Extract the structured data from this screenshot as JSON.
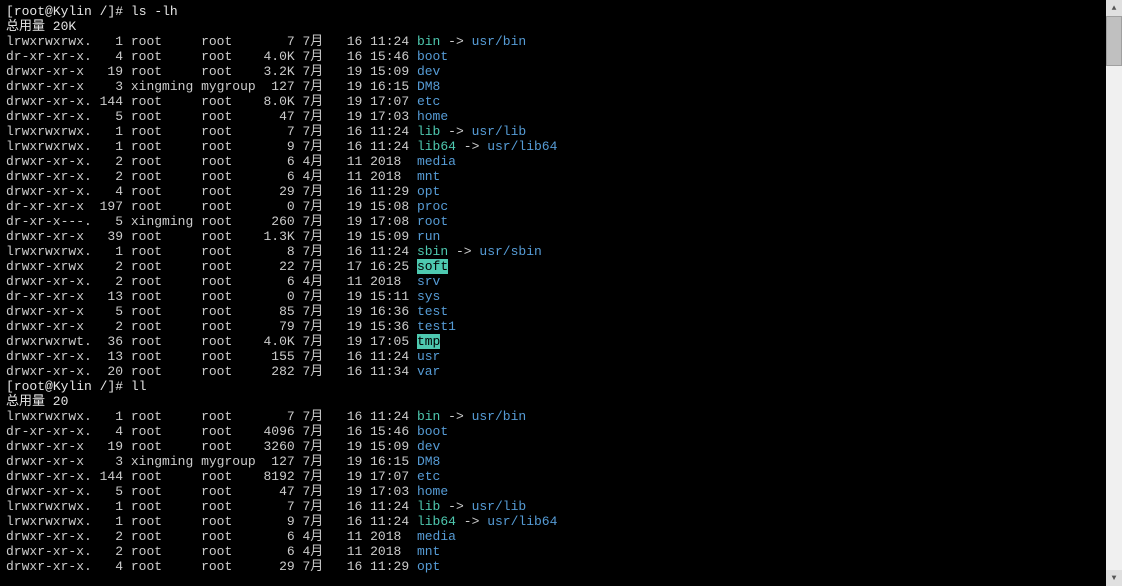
{
  "prompt1": {
    "user": "root",
    "host": "Kylin",
    "path": "/",
    "symbol": "#",
    "command": "ls -lh"
  },
  "total1": "总用量 20K",
  "listing1": [
    {
      "perms": "lrwxrwxrwx.",
      "links": "1",
      "owner": "root",
      "group": "root",
      "size": "7",
      "month": "7月",
      "day": "16",
      "time": "11:24",
      "name": "bin",
      "arrow": " -> ",
      "target": "usr/bin",
      "nameClass": "cyan",
      "targetClass": "blue"
    },
    {
      "perms": "dr-xr-xr-x.",
      "links": "4",
      "owner": "root",
      "group": "root",
      "size": "4.0K",
      "month": "7月",
      "day": "16",
      "time": "15:46",
      "name": "boot",
      "nameClass": "blue"
    },
    {
      "perms": "drwxr-xr-x",
      "links": "19",
      "owner": "root",
      "group": "root",
      "size": "3.2K",
      "month": "7月",
      "day": "19",
      "time": "15:09",
      "name": "dev",
      "nameClass": "blue"
    },
    {
      "perms": "drwxr-xr-x",
      "links": "3",
      "owner": "xingming",
      "group": "mygroup",
      "size": "127",
      "month": "7月",
      "day": "19",
      "time": "16:15",
      "name": "DM8",
      "nameClass": "blue"
    },
    {
      "perms": "drwxr-xr-x.",
      "links": "144",
      "owner": "root",
      "group": "root",
      "size": "8.0K",
      "month": "7月",
      "day": "19",
      "time": "17:07",
      "name": "etc",
      "nameClass": "blue"
    },
    {
      "perms": "drwxr-xr-x.",
      "links": "5",
      "owner": "root",
      "group": "root",
      "size": "47",
      "month": "7月",
      "day": "19",
      "time": "17:03",
      "name": "home",
      "nameClass": "blue"
    },
    {
      "perms": "lrwxrwxrwx.",
      "links": "1",
      "owner": "root",
      "group": "root",
      "size": "7",
      "month": "7月",
      "day": "16",
      "time": "11:24",
      "name": "lib",
      "arrow": " -> ",
      "target": "usr/lib",
      "nameClass": "cyan",
      "targetClass": "blue"
    },
    {
      "perms": "lrwxrwxrwx.",
      "links": "1",
      "owner": "root",
      "group": "root",
      "size": "9",
      "month": "7月",
      "day": "16",
      "time": "11:24",
      "name": "lib64",
      "arrow": " -> ",
      "target": "usr/lib64",
      "nameClass": "cyan",
      "targetClass": "blue"
    },
    {
      "perms": "drwxr-xr-x.",
      "links": "2",
      "owner": "root",
      "group": "root",
      "size": "6",
      "month": "4月",
      "day": "11",
      "time": "2018",
      "name": "media",
      "nameClass": "blue"
    },
    {
      "perms": "drwxr-xr-x.",
      "links": "2",
      "owner": "root",
      "group": "root",
      "size": "6",
      "month": "4月",
      "day": "11",
      "time": "2018",
      "name": "mnt",
      "nameClass": "blue"
    },
    {
      "perms": "drwxr-xr-x.",
      "links": "4",
      "owner": "root",
      "group": "root",
      "size": "29",
      "month": "7月",
      "day": "16",
      "time": "11:29",
      "name": "opt",
      "nameClass": "blue"
    },
    {
      "perms": "dr-xr-xr-x",
      "links": "197",
      "owner": "root",
      "group": "root",
      "size": "0",
      "month": "7月",
      "day": "19",
      "time": "15:08",
      "name": "proc",
      "nameClass": "blue"
    },
    {
      "perms": "dr-xr-x---.",
      "links": "5",
      "owner": "xingming",
      "group": "root",
      "size": "260",
      "month": "7月",
      "day": "19",
      "time": "17:08",
      "name": "root",
      "nameClass": "blue"
    },
    {
      "perms": "drwxr-xr-x",
      "links": "39",
      "owner": "root",
      "group": "root",
      "size": "1.3K",
      "month": "7月",
      "day": "19",
      "time": "15:09",
      "name": "run",
      "nameClass": "blue"
    },
    {
      "perms": "lrwxrwxrwx.",
      "links": "1",
      "owner": "root",
      "group": "root",
      "size": "8",
      "month": "7月",
      "day": "16",
      "time": "11:24",
      "name": "sbin",
      "arrow": " -> ",
      "target": "usr/sbin",
      "nameClass": "cyan",
      "targetClass": "blue"
    },
    {
      "perms": "drwxr-xrwx",
      "links": "2",
      "owner": "root",
      "group": "root",
      "size": "22",
      "month": "7月",
      "day": "17",
      "time": "16:25",
      "name": "soft",
      "nameClass": "hl-green"
    },
    {
      "perms": "drwxr-xr-x.",
      "links": "2",
      "owner": "root",
      "group": "root",
      "size": "6",
      "month": "4月",
      "day": "11",
      "time": "2018",
      "name": "srv",
      "nameClass": "blue"
    },
    {
      "perms": "dr-xr-xr-x",
      "links": "13",
      "owner": "root",
      "group": "root",
      "size": "0",
      "month": "7月",
      "day": "19",
      "time": "15:11",
      "name": "sys",
      "nameClass": "blue"
    },
    {
      "perms": "drwxr-xr-x",
      "links": "5",
      "owner": "root",
      "group": "root",
      "size": "85",
      "month": "7月",
      "day": "19",
      "time": "16:36",
      "name": "test",
      "nameClass": "blue"
    },
    {
      "perms": "drwxr-xr-x",
      "links": "2",
      "owner": "root",
      "group": "root",
      "size": "79",
      "month": "7月",
      "day": "19",
      "time": "15:36",
      "name": "test1",
      "nameClass": "blue"
    },
    {
      "perms": "drwxrwxrwt.",
      "links": "36",
      "owner": "root",
      "group": "root",
      "size": "4.0K",
      "month": "7月",
      "day": "19",
      "time": "17:05",
      "name": "tmp",
      "nameClass": "hl-green"
    },
    {
      "perms": "drwxr-xr-x.",
      "links": "13",
      "owner": "root",
      "group": "root",
      "size": "155",
      "month": "7月",
      "day": "16",
      "time": "11:24",
      "name": "usr",
      "nameClass": "blue"
    },
    {
      "perms": "drwxr-xr-x.",
      "links": "20",
      "owner": "root",
      "group": "root",
      "size": "282",
      "month": "7月",
      "day": "16",
      "time": "11:34",
      "name": "var",
      "nameClass": "blue"
    }
  ],
  "prompt2": {
    "user": "root",
    "host": "Kylin",
    "path": "/",
    "symbol": "#",
    "command": "ll"
  },
  "total2": "总用量 20",
  "listing2": [
    {
      "perms": "lrwxrwxrwx.",
      "links": "1",
      "owner": "root",
      "group": "root",
      "size": "7",
      "month": "7月",
      "day": "16",
      "time": "11:24",
      "name": "bin",
      "arrow": " -> ",
      "target": "usr/bin",
      "nameClass": "cyan",
      "targetClass": "blue"
    },
    {
      "perms": "dr-xr-xr-x.",
      "links": "4",
      "owner": "root",
      "group": "root",
      "size": "4096",
      "month": "7月",
      "day": "16",
      "time": "15:46",
      "name": "boot",
      "nameClass": "blue"
    },
    {
      "perms": "drwxr-xr-x",
      "links": "19",
      "owner": "root",
      "group": "root",
      "size": "3260",
      "month": "7月",
      "day": "19",
      "time": "15:09",
      "name": "dev",
      "nameClass": "blue"
    },
    {
      "perms": "drwxr-xr-x",
      "links": "3",
      "owner": "xingming",
      "group": "mygroup",
      "size": "127",
      "month": "7月",
      "day": "19",
      "time": "16:15",
      "name": "DM8",
      "nameClass": "blue"
    },
    {
      "perms": "drwxr-xr-x.",
      "links": "144",
      "owner": "root",
      "group": "root",
      "size": "8192",
      "month": "7月",
      "day": "19",
      "time": "17:07",
      "name": "etc",
      "nameClass": "blue"
    },
    {
      "perms": "drwxr-xr-x.",
      "links": "5",
      "owner": "root",
      "group": "root",
      "size": "47",
      "month": "7月",
      "day": "19",
      "time": "17:03",
      "name": "home",
      "nameClass": "blue"
    },
    {
      "perms": "lrwxrwxrwx.",
      "links": "1",
      "owner": "root",
      "group": "root",
      "size": "7",
      "month": "7月",
      "day": "16",
      "time": "11:24",
      "name": "lib",
      "arrow": " -> ",
      "target": "usr/lib",
      "nameClass": "cyan",
      "targetClass": "blue"
    },
    {
      "perms": "lrwxrwxrwx.",
      "links": "1",
      "owner": "root",
      "group": "root",
      "size": "9",
      "month": "7月",
      "day": "16",
      "time": "11:24",
      "name": "lib64",
      "arrow": " -> ",
      "target": "usr/lib64",
      "nameClass": "cyan",
      "targetClass": "blue"
    },
    {
      "perms": "drwxr-xr-x.",
      "links": "2",
      "owner": "root",
      "group": "root",
      "size": "6",
      "month": "4月",
      "day": "11",
      "time": "2018",
      "name": "media",
      "nameClass": "blue"
    },
    {
      "perms": "drwxr-xr-x.",
      "links": "2",
      "owner": "root",
      "group": "root",
      "size": "6",
      "month": "4月",
      "day": "11",
      "time": "2018",
      "name": "mnt",
      "nameClass": "blue"
    },
    {
      "perms": "drwxr-xr-x.",
      "links": "4",
      "owner": "root",
      "group": "root",
      "size": "29",
      "month": "7月",
      "day": "16",
      "time": "11:29",
      "name": "opt",
      "nameClass": "blue"
    }
  ]
}
